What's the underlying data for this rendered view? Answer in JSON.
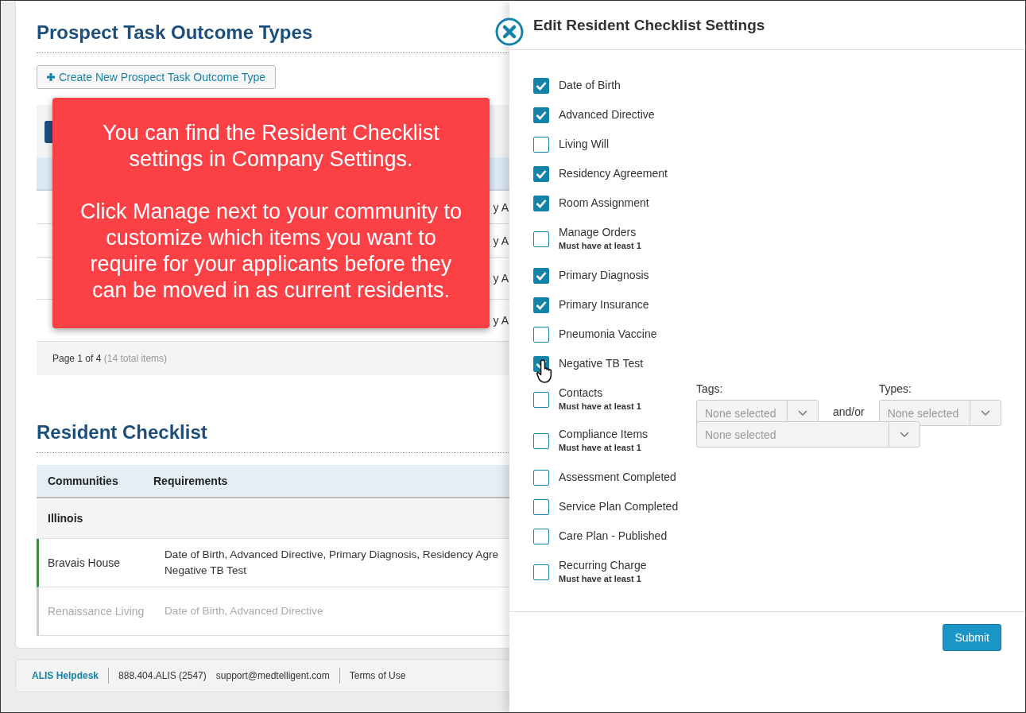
{
  "prospect": {
    "title": "Prospect Task Outcome Types",
    "create_button": "Create New Prospect Task Outcome Type",
    "rows": [
      {
        "last": "y A"
      },
      {
        "last": "y A"
      },
      {
        "last": "y A"
      },
      {
        "last": "y A"
      }
    ],
    "pager": {
      "page": "Page 1 of 4",
      "total": "(14 total items)"
    }
  },
  "callout": {
    "paragraphs": [
      "You can find the Resident Checklist settings in Company Settings.",
      "Click Manage next to your community to customize which items you want to require for your applicants before they can be moved in as current residents."
    ]
  },
  "checklist": {
    "title": "Resident Checklist",
    "columns": [
      "Communities",
      "Requirements"
    ],
    "groups": [
      {
        "name": "Illinois",
        "rows": [
          {
            "community": "Bravais House",
            "requirements": "Date of Birth, Advanced Directive, Primary Diagnosis, Residency Agre",
            "requirements_2": "Negative TB Test",
            "active": true
          },
          {
            "community": "Renaissance Living",
            "requirements": "Date of Birth, Advanced Directive",
            "active": false
          }
        ]
      }
    ]
  },
  "footer": {
    "helpdesk": "ALIS Helpdesk",
    "phone": "888.404.ALIS (2547)",
    "email": "support@medtelligent.com",
    "terms": "Terms of Use"
  },
  "panel": {
    "title": "Edit Resident Checklist Settings",
    "submit": "Submit",
    "items": [
      {
        "kind": "plain",
        "label": "Date of Birth",
        "checked": true
      },
      {
        "kind": "plain",
        "label": "Advanced Directive",
        "checked": true
      },
      {
        "kind": "plain",
        "label": "Living Will",
        "checked": false
      },
      {
        "kind": "plain",
        "label": "Residency Agreement",
        "checked": true
      },
      {
        "kind": "plain",
        "label": "Room Assignment",
        "checked": true
      },
      {
        "kind": "note",
        "label": "Manage Orders",
        "note": "Must have at least 1",
        "checked": false
      },
      {
        "kind": "plain",
        "label": "Primary Diagnosis",
        "checked": true
      },
      {
        "kind": "plain",
        "label": "Primary Insurance",
        "checked": true
      },
      {
        "kind": "plain",
        "label": "Pneumonia Vaccine",
        "checked": false
      },
      {
        "kind": "plain",
        "label": "Negative TB Test",
        "checked": true,
        "cursor": true
      },
      {
        "kind": "two-selects",
        "label": "Contacts",
        "note": "Must have at least 1",
        "checked": false,
        "select_1": {
          "label": "Tags:",
          "placeholder": "None selected"
        },
        "joiner": "and/or",
        "select_2": {
          "label": "Types:",
          "placeholder": "None selected"
        }
      },
      {
        "kind": "one-select",
        "label": "Compliance Items",
        "note": "Must have at least 1",
        "checked": false,
        "select_1": {
          "placeholder": "None selected"
        }
      },
      {
        "kind": "plain",
        "label": "Assessment Completed",
        "checked": false
      },
      {
        "kind": "plain",
        "label": "Service Plan Completed",
        "checked": false
      },
      {
        "kind": "plain",
        "label": "Care Plan - Published",
        "checked": false
      },
      {
        "kind": "note",
        "label": "Recurring Charge",
        "note": "Must have at least 1",
        "checked": false
      }
    ]
  }
}
